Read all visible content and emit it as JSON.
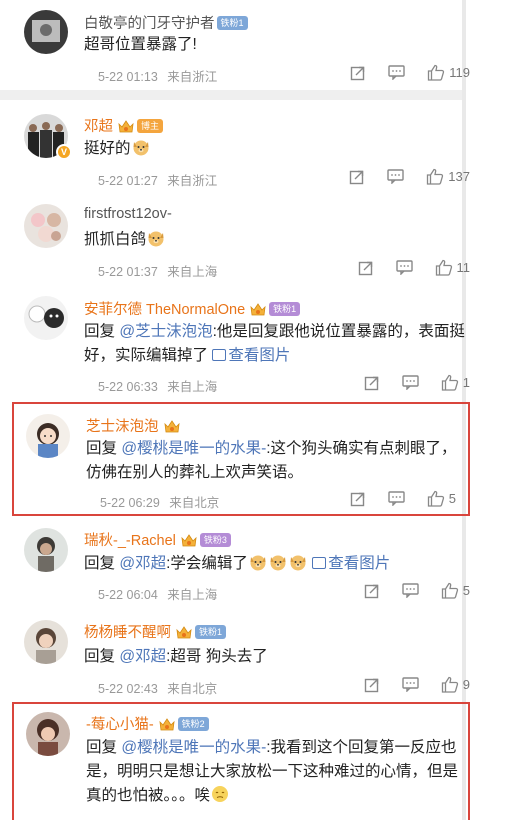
{
  "comments": [
    {
      "name": "白敬亭的门牙守护者",
      "tag": "铁粉1",
      "text": "超哥位置暴露了!",
      "time": "5-22 01:13",
      "loc": "来自浙江",
      "likes": "119"
    },
    {
      "name": "邓超",
      "tag": "博主",
      "text": "挺好的",
      "time": "5-22 01:27",
      "loc": "来自浙江",
      "likes": "137"
    },
    {
      "name": "firstfrost12ov-",
      "text": "抓抓白鸽",
      "time": "5-22 01:37",
      "loc": "来自上海",
      "likes": "11"
    },
    {
      "name": "安菲尔德 TheNormalOne",
      "tag": "铁粉1",
      "reply_prefix": "回复",
      "mention": "@芝士沫泡泡",
      "text": ":他是回复跟他说位置暴露的，表面挺好，实际编辑掉了",
      "pic_label": "查看图片",
      "time": "5-22 06:33",
      "loc": "来自上海",
      "likes": "1"
    },
    {
      "name": "芝士沫泡泡",
      "reply_prefix": "回复",
      "mention": "@樱桃是唯一的水果-",
      "text": ":这个狗头确实有点刺眼了，仿佛在别人的葬礼上欢声笑语。",
      "time": "5-22 06:29",
      "loc": "来自北京",
      "likes": "5"
    },
    {
      "name": "瑞秋-_-Rachel",
      "tag": "铁粉3",
      "reply_prefix": "回复",
      "mention": "@邓超",
      "text": ":学会编辑了",
      "pic_label": "查看图片",
      "time": "5-22 06:04",
      "loc": "来自上海",
      "likes": "5"
    },
    {
      "name": "杨杨睡不醒啊",
      "tag": "铁粉1",
      "reply_prefix": "回复",
      "mention": "@邓超",
      "text": ":超哥 狗头去了",
      "time": "5-22 02:43",
      "loc": "来自北京",
      "likes": "9"
    },
    {
      "name": "-莓心小猫-",
      "tag": "铁粉2",
      "reply_prefix": "回复",
      "mention": "@樱桃是唯一的水果-",
      "text": ":我看到这个回复第一反应也是，明明只是想让大家放松一下这种难过的心情，但是真的也怕被。。。唉"
    }
  ],
  "icons": [
    "share-icon",
    "comment-icon",
    "like-icon",
    "crown-icon",
    "dog-emoji",
    "picture-icon",
    "verified-badge"
  ],
  "colors": {
    "highlight_frame": "#d9453c",
    "link": "#4e76b8",
    "vip_name": "#e8741a"
  }
}
